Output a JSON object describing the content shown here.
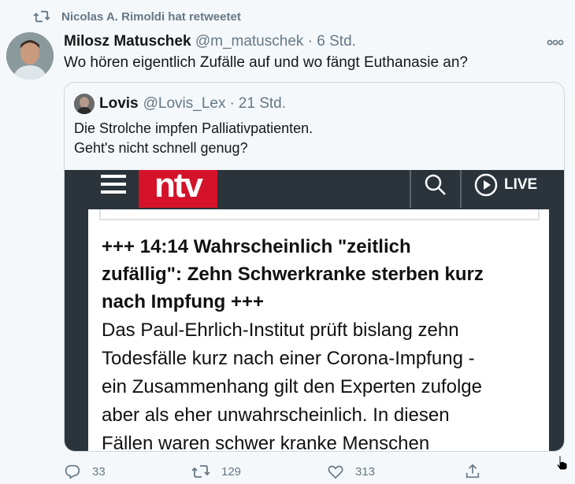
{
  "retweet": {
    "text": "Nicolas A. Rimoldi hat retweetet"
  },
  "tweet": {
    "author_name": "Milosz Matuschek",
    "handle": "@m_matuschek",
    "dot": "·",
    "time": "6 Std.",
    "text": "Wo hören eigentlich Zufälle auf und wo fängt Euthanasie an?"
  },
  "quote": {
    "author_name": "Lovis",
    "handle": "@Lovis_Lex",
    "dot": "·",
    "time": "21 Std.",
    "line1": "Die Strolche impfen Palliativpatienten.",
    "line2": "Geht's nicht schnell genug?",
    "image": {
      "logo": "ntv",
      "live_label": "LIVE",
      "headline1": "+++ 14:14 Wahrscheinlich \"zeitlich",
      "headline2": "zufällig\": Zehn Schwerkranke sterben kurz",
      "headline3": "nach Impfung +++",
      "body1": "Das Paul-Ehrlich-Institut prüft bislang zehn",
      "body2": "Todesfälle kurz nach einer Corona-Impfung -",
      "body3": "ein Zusammenhang gilt den Experten zufolge",
      "body4": "aber als eher unwahrscheinlich. In diesen",
      "body5": "Fällen waren schwer kranke Menschen"
    }
  },
  "actions": {
    "replies": "33",
    "retweets": "129",
    "likes": "313"
  },
  "colors": {
    "accent": "#1da1f2",
    "muted": "#657786",
    "ntv_red": "#d4132a"
  }
}
